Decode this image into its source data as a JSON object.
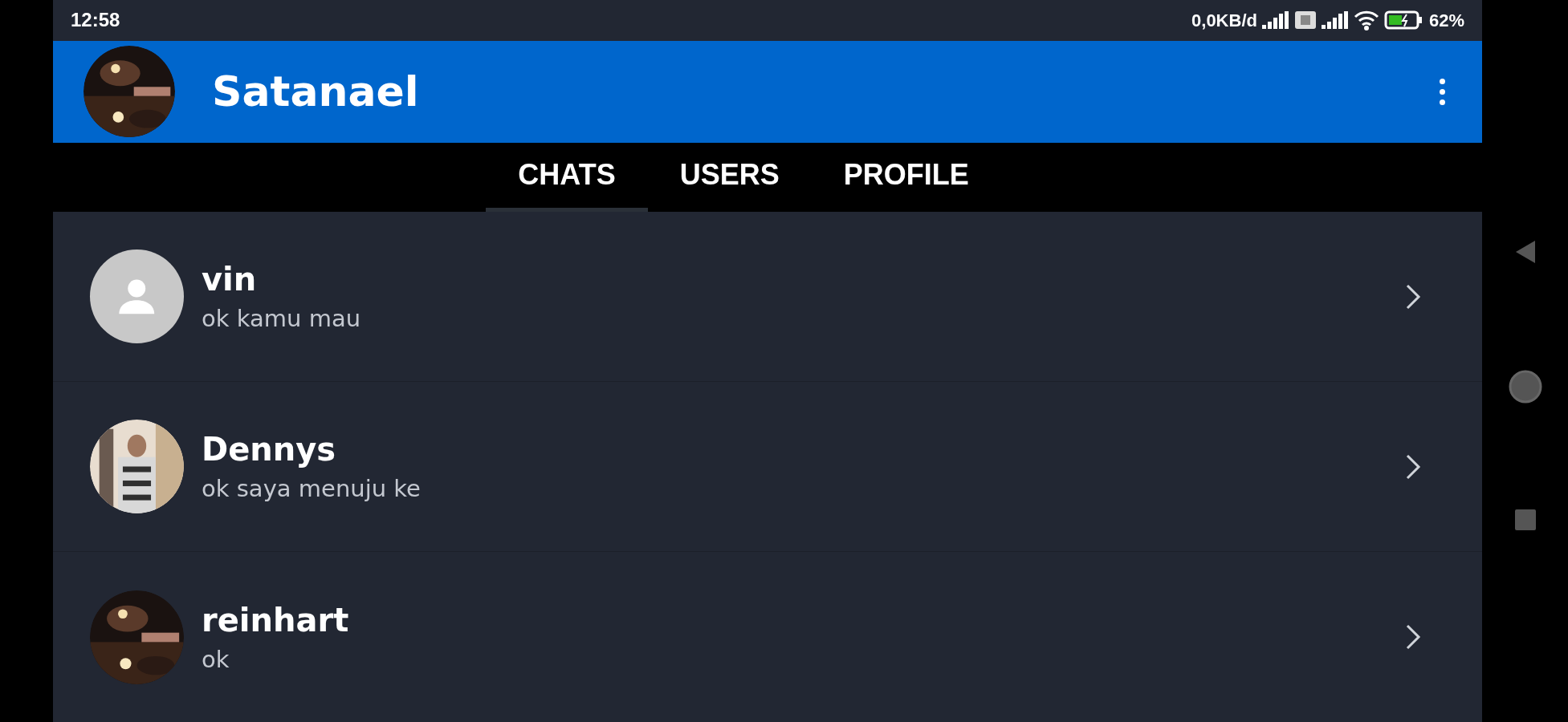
{
  "status_bar": {
    "time": "12:58",
    "data_rate": "0,0KB/d",
    "battery": "62%"
  },
  "app_bar": {
    "title": "Satanael"
  },
  "tabs": [
    {
      "label": "CHATS",
      "selected": true
    },
    {
      "label": "USERS",
      "selected": false
    },
    {
      "label": "PROFILE",
      "selected": false
    }
  ],
  "chats": [
    {
      "name": "vin",
      "message": "ok kamu mau",
      "avatar": {
        "kind": "placeholder"
      }
    },
    {
      "name": "Dennys",
      "message": "ok saya menuju ke"
    },
    {
      "name": "reinhart",
      "message": "ok"
    }
  ]
}
